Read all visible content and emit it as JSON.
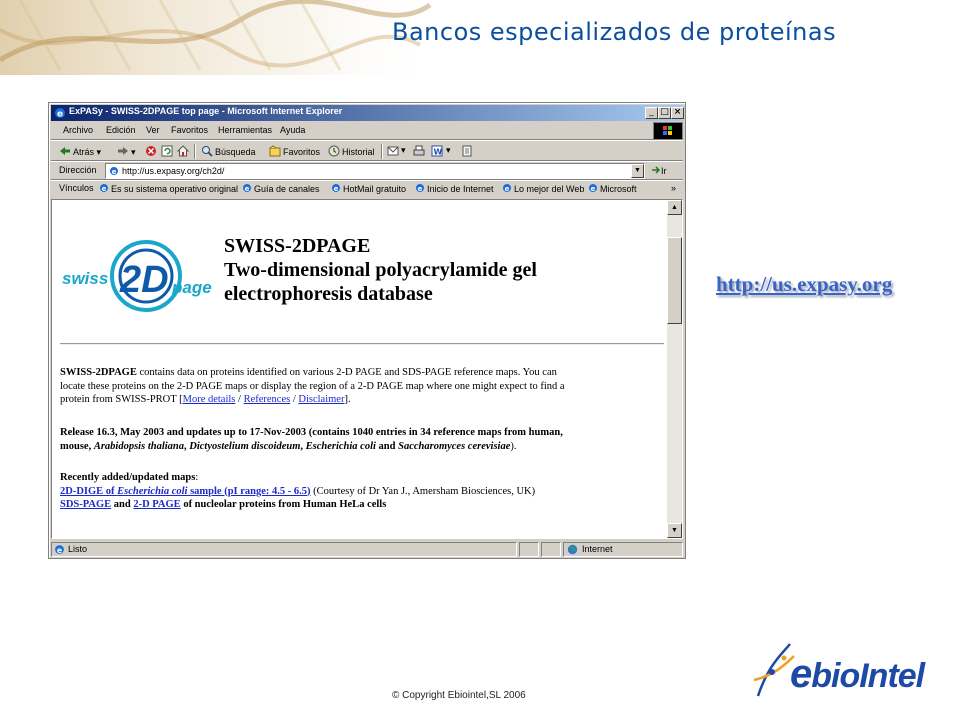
{
  "slide": {
    "title": "Bancos especializados de proteínas",
    "url": "http://us.expasy.org",
    "copyright": "© Copyright Ebiointel,SL 2006",
    "logo_text": "bioIntel",
    "logo_prefix": "e"
  },
  "window": {
    "title": "ExPASy - SWISS-2DPAGE top page - Microsoft Internet Explorer",
    "controls": [
      "_",
      "□",
      "×"
    ]
  },
  "menu": [
    "Archivo",
    "Edición",
    "Ver",
    "Favoritos",
    "Herramientas",
    "Ayuda"
  ],
  "toolbar": {
    "back": "Atrás",
    "search": "Búsqueda",
    "favorites": "Favoritos",
    "history": "Historial"
  },
  "address": {
    "label": "Dirección",
    "value": "http://us.expasy.org/ch2d/",
    "go": "Ir"
  },
  "links": {
    "label": "Vínculos",
    "items": [
      "Es su sistema operativo original",
      "Guía de canales",
      "HotMail gratuito",
      "Inicio de Internet",
      "Lo mejor del Web",
      "Microsoft"
    ]
  },
  "page": {
    "logo_word1": "swiss",
    "logo_word2": "2D",
    "logo_word3": "page",
    "title_l1": "SWISS-2DPAGE",
    "title_l2": "Two-dimensional polyacrylamide gel",
    "title_l3": "electrophoresis database",
    "intro_b": "SWISS-2DPAGE",
    "intro_1": " contains data on proteins identified on various 2-D PAGE and SDS-PAGE reference maps. You can",
    "intro_2": "locate these proteins on the 2-D PAGE maps or display the region of a 2-D PAGE map where one might expect to find a",
    "intro_3a": "protein from SWISS-PROT [",
    "link_more": "More details",
    "slash1": " / ",
    "link_refs": "References",
    "slash2": " / ",
    "link_discl": "Disclaimer",
    "intro_3b": "].",
    "release_1": "Release 16.3, May 2003 and updates up to 17-Nov-2003 (contains 1040 entries in 34 reference maps from human,",
    "release_2a": "mouse, ",
    "species_1": "Arabidopsis thaliana",
    "comma1": ", ",
    "species_2": "Dictyostelium discoideum",
    "comma2": ", ",
    "species_3": "Escherichia coli",
    "and_word": " and ",
    "species_4": "Saccharomyces cerevisiae",
    "release_2b": ").",
    "recent_label": "Recently added/updated maps",
    "colon": ":",
    "dige_link_a": "2D-DIGE of ",
    "dige_link_i": "Escherichia coli",
    "dige_link_b": " sample (pI range: 4.5 - 6.5)",
    "dige_rest": " (Courtesy of Dr Yan J., Amersham Biosciences, UK)",
    "sds_link": "SDS-PAGE",
    "and2": " and ",
    "twod_link": "2-D PAGE",
    "nucleolar": " of nucleolar proteins from Human HeLa cells"
  },
  "status": {
    "left": "Listo",
    "zone": "Internet"
  }
}
